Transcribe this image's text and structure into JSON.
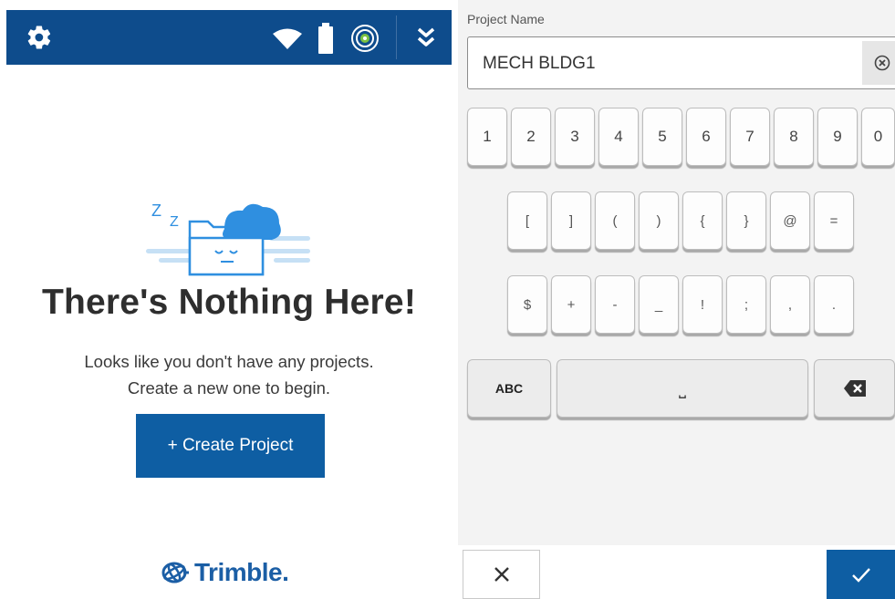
{
  "left": {
    "empty_state": {
      "title": "There's Nothing Here!",
      "line1": "Looks like you don't have any projects.",
      "line2": "Create a new one to begin.",
      "create_label": "+ Create Project"
    },
    "logo_text": "Trimble.",
    "topbar_icons": [
      "gear-icon",
      "wifi-icon",
      "battery-icon",
      "gps-target-icon",
      "double-chevron-down-icon"
    ]
  },
  "right": {
    "field_label": "Project Name",
    "field_value": "MECH BLDG1",
    "keyboard": {
      "row1": [
        "1",
        "2",
        "3",
        "4",
        "5",
        "6",
        "7",
        "8",
        "9",
        "0"
      ],
      "row2": [
        "[",
        "]",
        "(",
        ")",
        "{",
        "}",
        "@",
        "="
      ],
      "row3": [
        "$",
        "+",
        "-",
        "_",
        "!",
        ";",
        ",",
        "."
      ],
      "abc_label": "ABC",
      "space_glyph": "⎵"
    }
  },
  "colors": {
    "header_blue": "#0e4c8c",
    "button_blue": "#0e5ea3",
    "illustration_blue": "#2f8fe0"
  }
}
